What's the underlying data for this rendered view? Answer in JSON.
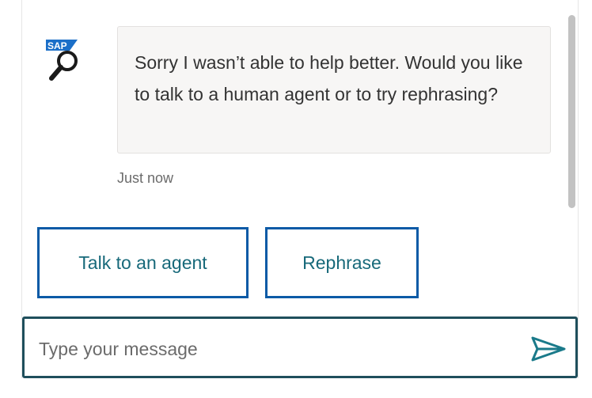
{
  "colors": {
    "accent_blue": "#0b5aa6",
    "button_text": "#17697a",
    "composer_border": "#1f4f5c",
    "send_icon": "#1a7a8a",
    "bubble_bg": "#f7f6f5"
  },
  "bot": {
    "avatar_icon": "sap-search-logo-icon",
    "logo_text": "SAP"
  },
  "message": {
    "text": "Sorry I wasn’t able to help better. Would you like to talk to a human agent or to try rephrasing?",
    "timestamp": "Just now"
  },
  "actions": [
    {
      "label": "Talk to an agent"
    },
    {
      "label": "Rephrase"
    }
  ],
  "composer": {
    "placeholder": "Type your message",
    "value": "",
    "send_icon": "send-icon"
  }
}
